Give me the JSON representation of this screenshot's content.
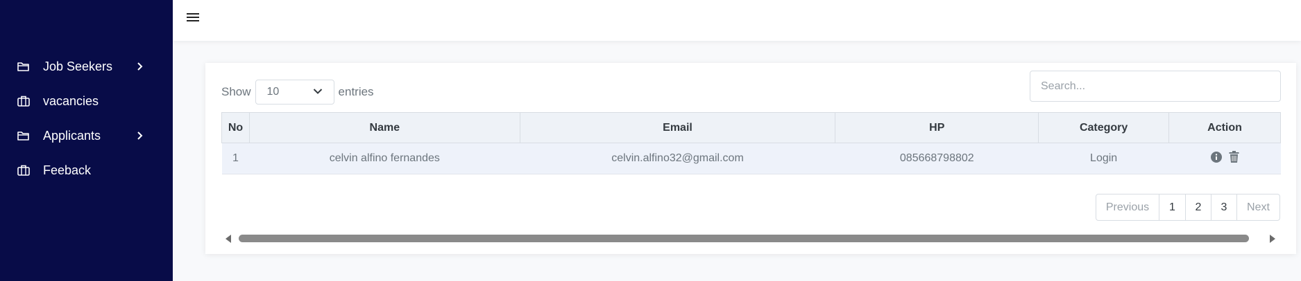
{
  "sidebar": {
    "items": [
      {
        "label": "Job Seekers",
        "icon": "folder-icon",
        "has_submenu": true
      },
      {
        "label": "vacancies",
        "icon": "briefcase-icon",
        "has_submenu": false
      },
      {
        "label": "Applicants",
        "icon": "folder-icon",
        "has_submenu": true
      },
      {
        "label": "Feeback",
        "icon": "briefcase-icon",
        "has_submenu": false
      }
    ]
  },
  "topbar": {
    "menu_icon": "hamburger-icon"
  },
  "table_controls": {
    "show_label": "Show",
    "entries_value": "10",
    "entries_label": "entries",
    "search_placeholder": "Search..."
  },
  "table": {
    "columns": [
      "No",
      "Name",
      "Email",
      "HP",
      "Category",
      "Action"
    ],
    "rows": [
      {
        "no": "1",
        "name": "celvin alfino fernandes",
        "email": "celvin.alfino32@gmail.com",
        "hp": "085668798802",
        "category": "Login"
      }
    ],
    "action_icons": [
      "info-icon",
      "trash-icon"
    ]
  },
  "pagination": {
    "previous": "Previous",
    "pages": [
      "1",
      "2",
      "3"
    ],
    "next": "Next"
  },
  "colors": {
    "sidebar_bg": "#080c48",
    "header_bg": "#eef2f7",
    "row_bg": "#eef2fa"
  }
}
